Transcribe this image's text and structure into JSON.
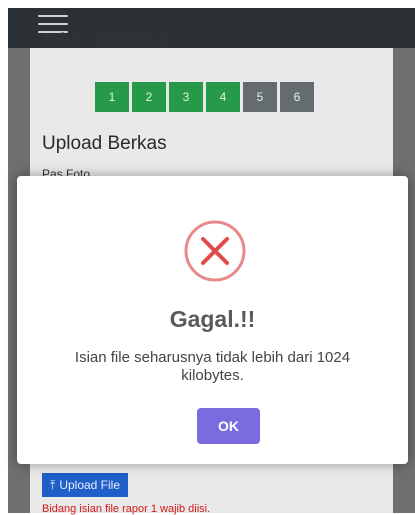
{
  "header": {
    "menu_icon": "hamburger-menu-icon"
  },
  "form": {
    "partial_heading": "Jalur: Prestasi",
    "steps": [
      "1",
      "2",
      "3",
      "4",
      "5",
      "6"
    ],
    "completed_steps": 4,
    "upload_heading": "Upload Berkas",
    "partial_label": "Pas Foto",
    "upload_button": {
      "icon": "upload-icon",
      "label": "Upload File"
    },
    "error_text": "Bidang isian file rapor 1 wajib diisi."
  },
  "dialog": {
    "icon": "error-x-icon",
    "title": "Gagal.!!",
    "message": "Isian file seharusnya tidak lebih dari 1024 kilobytes.",
    "ok_label": "OK"
  },
  "colors": {
    "accent": "#7a6ce0",
    "error": "#e24b4b",
    "step_done": "#279a4a",
    "step_todo": "#656c70",
    "upload_button": "#1f5fc7"
  }
}
